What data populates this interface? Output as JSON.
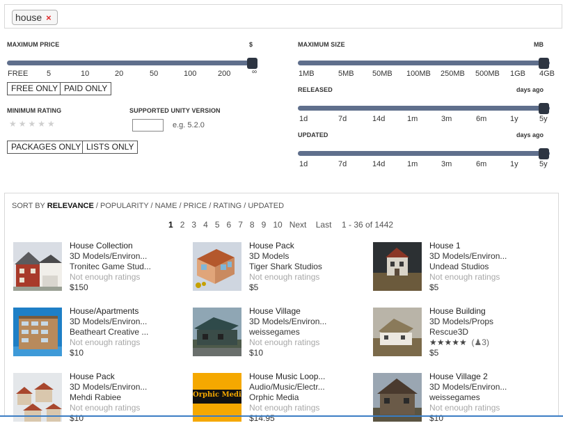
{
  "search": {
    "tag": "house",
    "remove_glyph": "×"
  },
  "filters": {
    "max_price": {
      "label": "MAXIMUM PRICE",
      "unit": "$",
      "ticks": [
        "FREE",
        "5",
        "10",
        "20",
        "50",
        "100",
        "200",
        "∞"
      ],
      "selected": "∞"
    },
    "max_size": {
      "label": "MAXIMUM SIZE",
      "unit": "MB",
      "ticks": [
        "1MB",
        "5MB",
        "50MB",
        "100MB",
        "250MB",
        "500MB",
        "1GB",
        "4GB"
      ],
      "selected": "4GB"
    },
    "released": {
      "label": "RELEASED",
      "unit": "days ago",
      "ticks": [
        "1d",
        "7d",
        "14d",
        "1m",
        "3m",
        "6m",
        "1y",
        "5y"
      ],
      "selected": "5y"
    },
    "updated": {
      "label": "UPDATED",
      "unit": "days ago",
      "ticks": [
        "1d",
        "7d",
        "14d",
        "1m",
        "3m",
        "6m",
        "1y",
        "5y"
      ],
      "selected": "5y"
    },
    "free_only": "FREE ONLY",
    "paid_only": "PAID ONLY",
    "min_rating_label": "MINIMUM RATING",
    "min_rating_stars": "★★★★★",
    "unity_version_label": "SUPPORTED UNITY VERSION",
    "unity_version_value": "",
    "unity_version_hint": "e.g. 5.2.0",
    "packages_only": "PACKAGES ONLY",
    "lists_only": "LISTS ONLY"
  },
  "sort": {
    "prefix": "SORT BY",
    "options": [
      "RELEVANCE",
      "POPULARITY",
      "NAME",
      "PRICE",
      "RATING",
      "UPDATED"
    ],
    "active": "RELEVANCE",
    "separator": " / "
  },
  "pagination": {
    "pages": [
      "1",
      "2",
      "3",
      "4",
      "5",
      "6",
      "7",
      "8",
      "9",
      "10"
    ],
    "current": "1",
    "next": "Next",
    "last": "Last",
    "range": "1 - 36 of 1442"
  },
  "items": [
    {
      "title": "House Collection",
      "category": "3D Models/Environ...",
      "publisher": "Tronitec Game Stud...",
      "rating": "Not enough ratings",
      "price": "$150"
    },
    {
      "title": "House Pack",
      "category": "3D Models",
      "publisher": "Tiger Shark Studios",
      "rating": "Not enough ratings",
      "price": "$5"
    },
    {
      "title": "House 1",
      "category": "3D Models/Environ...",
      "publisher": "Undead Studios",
      "rating": "Not enough ratings",
      "price": "$5"
    },
    {
      "title": "House/Apartments",
      "category": "3D Models/Environ...",
      "publisher": "Beatheart Creative ...",
      "rating": "Not enough ratings",
      "price": "$10"
    },
    {
      "title": "House Village",
      "category": "3D Models/Environ...",
      "publisher": "weissegames",
      "rating": "Not enough ratings",
      "price": "$10"
    },
    {
      "title": "House Building",
      "category": "3D Models/Props",
      "publisher": "Rescue3D",
      "rating": "★★★★★",
      "rating_count": "3",
      "price": "$5"
    },
    {
      "title": "House Pack",
      "category": "3D Models/Environ...",
      "publisher": "Mehdi Rabiee",
      "rating": "Not enough ratings",
      "price": "$10"
    },
    {
      "title": "House Music Loop...",
      "category": "Audio/Music/Electr...",
      "publisher": "Orphic Media",
      "rating": "Not enough ratings",
      "price": "$14.95"
    },
    {
      "title": "House Village 2",
      "category": "3D Models/Environ...",
      "publisher": "weissegames",
      "rating": "Not enough ratings",
      "price": "$10"
    }
  ],
  "thumb_logo_text": "Orphic Media",
  "colors": {
    "slider_track": "#5f6f8c",
    "slider_knob": "#2d3542",
    "remove": "#e02b2b",
    "accent_line": "#3b7dc4"
  }
}
